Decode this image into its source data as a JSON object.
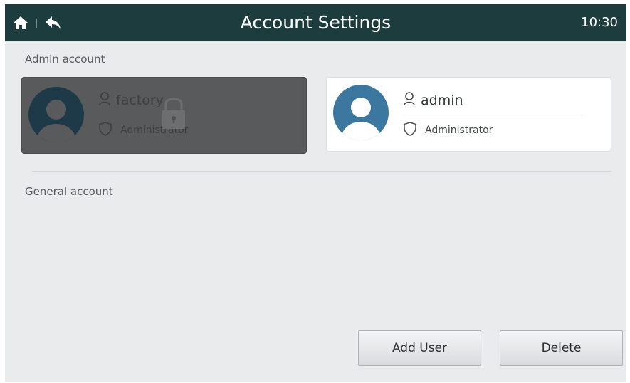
{
  "header": {
    "title": "Account Settings",
    "time": "10:30",
    "home_icon": "home-icon",
    "back_icon": "back-arrow-icon",
    "background_color": "#1d3c3d"
  },
  "admin_section": {
    "label": "Admin account",
    "accounts": [
      {
        "name": "factory",
        "role": "Administrator",
        "locked": true,
        "avatar_icon": "user-avatar-icon",
        "user_icon": "person-icon",
        "role_icon": "shield-icon",
        "lock_icon": "lock-icon",
        "avatar_color": "#1e3a48"
      },
      {
        "name": "admin",
        "role": "Administrator",
        "locked": false,
        "avatar_icon": "user-avatar-icon",
        "user_icon": "person-icon",
        "role_icon": "shield-icon",
        "avatar_color": "#3c77a0"
      }
    ]
  },
  "general_section": {
    "label": "General account",
    "accounts": []
  },
  "actions": {
    "add_user_label": "Add User",
    "delete_label": "Delete"
  }
}
